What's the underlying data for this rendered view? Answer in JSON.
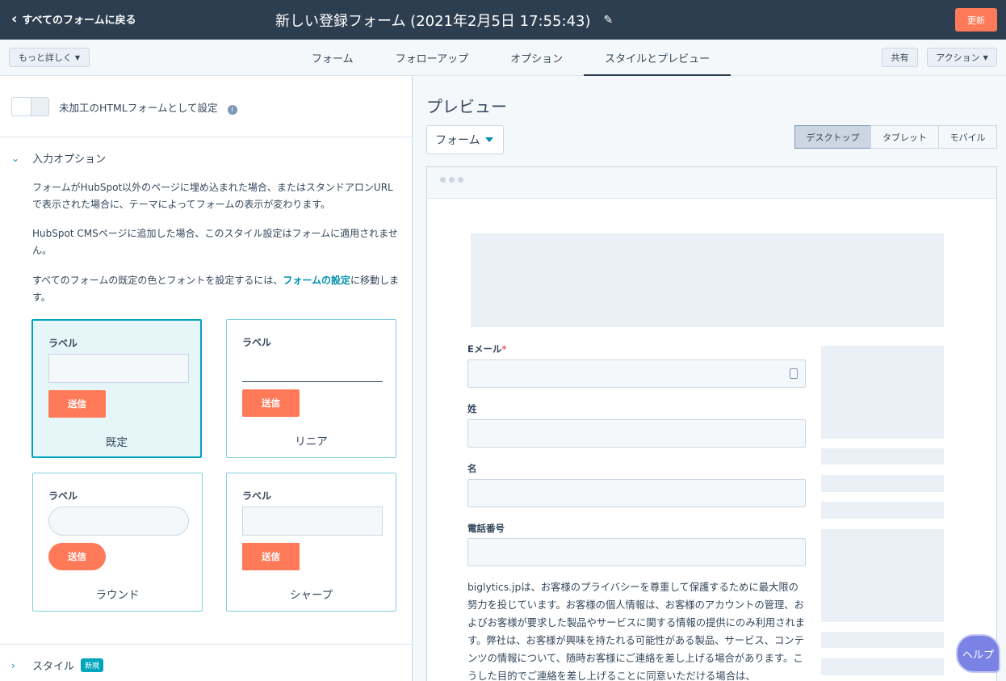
{
  "header": {
    "back_label": "すべてのフォームに戻る",
    "title": "新しい登録フォーム (2021年2月5日 17:55:43)",
    "update_label": "更新"
  },
  "subnav": {
    "more_label": "もっと詳しく",
    "tabs": [
      "フォーム",
      "フォローアップ",
      "オプション",
      "スタイルとプレビュー"
    ],
    "share_label": "共有",
    "actions_label": "アクション"
  },
  "left": {
    "raw_html_label": "未加工のHTMLフォームとして設定",
    "input_options_title": "入力オプション",
    "para1": "フォームがHubSpot以外のページに埋め込まれた場合、またはスタンドアロンURLで表示された場合に、テーマによってフォームの表示が変わります。",
    "para2": "HubSpot CMSページに追加した場合、このスタイル設定はフォームに適用されません。",
    "para3_before": "すべてのフォームの既定の色とフォントを設定するには、",
    "para3_link": "フォームの設定",
    "para3_after": "に移動します。",
    "cards": [
      {
        "label": "ラベル",
        "submit": "送信",
        "name": "既定"
      },
      {
        "label": "ラベル",
        "submit": "送信",
        "name": "リニア"
      },
      {
        "label": "ラベル",
        "submit": "送信",
        "name": "ラウンド"
      },
      {
        "label": "ラベル",
        "submit": "送信",
        "name": "シャープ"
      }
    ],
    "style_section_title": "スタイル",
    "new_badge": "新規"
  },
  "right": {
    "preview_title": "プレビュー",
    "form_dropdown": "フォーム",
    "devices": [
      "デスクトップ",
      "タブレット",
      "モバイル"
    ],
    "fields": [
      {
        "label": "Eメール",
        "required_mark": "*"
      },
      {
        "label": "姓"
      },
      {
        "label": "名"
      },
      {
        "label": "電話番号"
      }
    ],
    "privacy_text": "biglytics.jpは、お客様のプライバシーを尊重して保護するために最大限の努力を投じています。お客様の個人情報は、お客様のアカウントの管理、およびお客様が要求した製品やサービスに関する情報の提供にのみ利用されます。弊社は、お客様が興味を持たれる可能性がある製品、サービス、コンテンツの情報について、随時お客様にご連絡を差し上げる場合があります。こうした目的でご連絡を差し上げることに同意いただける場合は、"
  },
  "help_label": "ヘルプ",
  "colors": {
    "header_bg": "#2d3e50",
    "accent_orange": "#ff7a59",
    "accent_teal": "#00a4bd",
    "help_purple": "#7b82e6"
  }
}
